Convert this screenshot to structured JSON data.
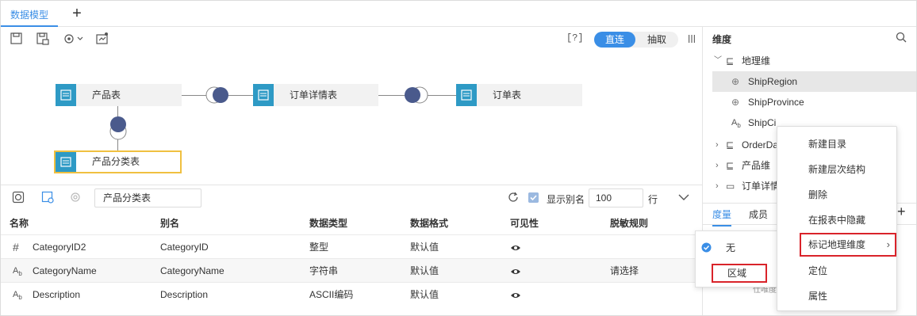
{
  "tabs": [
    {
      "label": "数据模型"
    }
  ],
  "toolbar": {
    "help": "[?]",
    "mode_direct": "直连",
    "mode_extract": "抽取"
  },
  "canvas": {
    "tables": [
      {
        "label": "产品表"
      },
      {
        "label": "订单详情表"
      },
      {
        "label": "订单表"
      },
      {
        "label": "产品分类表"
      }
    ]
  },
  "field_panel": {
    "table_name": "产品分类表",
    "show_alias_label": "显示别名",
    "rows_value": "100",
    "rows_unit": "行",
    "headers": {
      "name": "名称",
      "alias": "别名",
      "type": "数据类型",
      "format": "数据格式",
      "visibility": "可见性",
      "mask": "脱敏规则"
    },
    "rows": [
      {
        "name": "CategoryID2",
        "alias": "CategoryID",
        "type": "整型",
        "format": "默认值",
        "mask": ""
      },
      {
        "name": "CategoryName",
        "alias": "CategoryName",
        "type": "字符串",
        "format": "默认值",
        "mask": "请选择"
      },
      {
        "name": "Description",
        "alias": "Description",
        "type": "ASCII编码",
        "format": "默认值",
        "mask": ""
      }
    ]
  },
  "right_panel": {
    "title": "维度",
    "tree": {
      "geo": "地理维",
      "ship_region": "ShipRegion",
      "ship_province": "ShipProvince",
      "ship_city": "ShipCity",
      "order_date": "OrderDa",
      "product": "产品维",
      "order_detail": "订单详情"
    },
    "tab_measure": "度量",
    "tab_member": "成员",
    "hint_partial": "仕唯度"
  },
  "context_menu": {
    "items": [
      "新建目录",
      "新建层次结构",
      "删除",
      "在报表中隐藏",
      "标记地理维度",
      "定位",
      "属性"
    ]
  },
  "geo_submenu": {
    "items": [
      "无",
      "区域"
    ]
  },
  "colors": {
    "accent": "#3a8ee6",
    "table_icon": "#2e9ac5",
    "join_node": "#4a5a8c",
    "highlight": "#d9232a",
    "selected_table_border": "#f0c040"
  }
}
